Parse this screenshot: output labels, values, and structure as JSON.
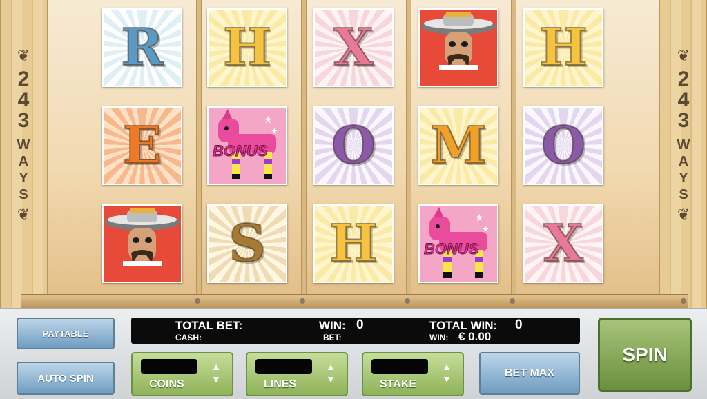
{
  "game": {
    "ways_number": "243",
    "ways_word": "WAYS",
    "reels": [
      [
        {
          "type": "letter",
          "letter": "R",
          "style": "blue"
        },
        {
          "type": "letter",
          "letter": "E",
          "style": "orange"
        },
        {
          "type": "bandit"
        }
      ],
      [
        {
          "type": "letter",
          "letter": "H",
          "style": "yellow"
        },
        {
          "type": "bonus",
          "label": "BONUS"
        },
        {
          "type": "letter",
          "letter": "S",
          "style": "brown"
        }
      ],
      [
        {
          "type": "letter",
          "letter": "X",
          "style": "pink"
        },
        {
          "type": "letter",
          "letter": "O",
          "style": "purple"
        },
        {
          "type": "letter",
          "letter": "H",
          "style": "yellow"
        }
      ],
      [
        {
          "type": "bandit"
        },
        {
          "type": "letter",
          "letter": "M",
          "style": "gold"
        },
        {
          "type": "bonus",
          "label": "BONUS"
        }
      ],
      [
        {
          "type": "letter",
          "letter": "H",
          "style": "yellow"
        },
        {
          "type": "letter",
          "letter": "O",
          "style": "purple"
        },
        {
          "type": "letter",
          "letter": "X",
          "style": "pink"
        }
      ]
    ]
  },
  "panel": {
    "paytable_label": "PAYTABLE",
    "autospin_label": "AUTO SPIN",
    "total_bet_label": "TOTAL BET:",
    "cash_label": "CASH:",
    "win_label": "WIN:",
    "win_value": "0",
    "bet_label": "BET:",
    "total_win_label": "TOTAL WIN:",
    "total_win_value": "0",
    "win2_label": "WIN:",
    "win2_value": "€ 0.00",
    "coins_label": "COINS",
    "lines_label": "LINES",
    "stake_label": "STAKE",
    "betmax_label": "BET MAX",
    "spin_label": "SPIN"
  },
  "colors": {
    "spin_green": "#7a9c4a",
    "button_blue": "#8fb5d6",
    "info_black": "#0b0b0b"
  }
}
